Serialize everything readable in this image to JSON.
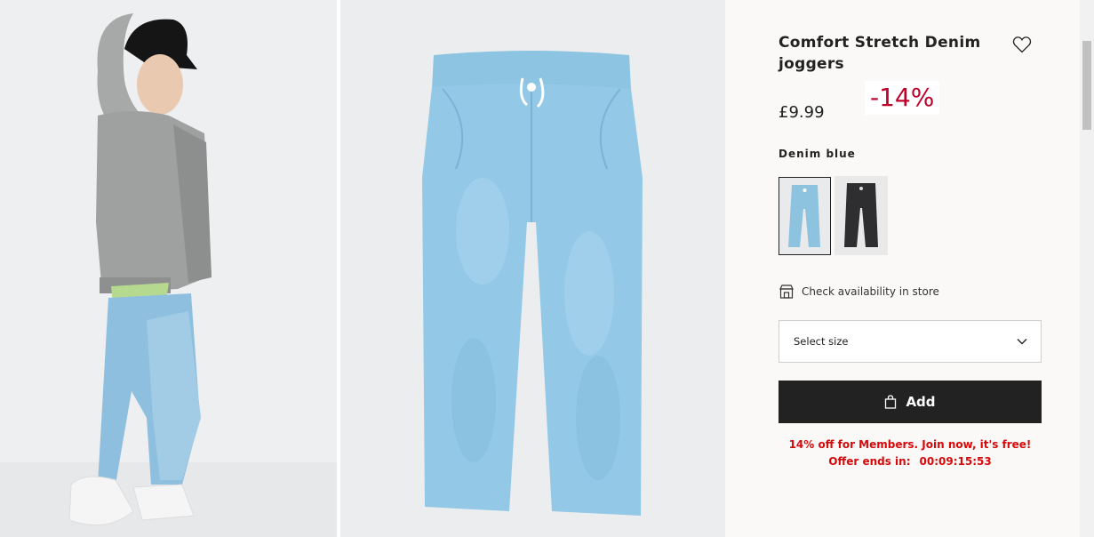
{
  "product": {
    "title": "Comfort Stretch Denim joggers",
    "price": "£9.99",
    "discount_badge": "-14%",
    "color_name": "Denim blue",
    "swatches": [
      {
        "name": "Denim blue",
        "selected": true,
        "color": "#8ec3e0"
      },
      {
        "name": "Black",
        "selected": false,
        "color": "#2e2e30"
      }
    ]
  },
  "actions": {
    "store_check": "Check availability in store",
    "size_placeholder": "Select size",
    "add_label": "Add"
  },
  "promo": {
    "members_text": "14% off for Members. Join now, it's free!",
    "offer_label": "Offer ends in:",
    "countdown": "00:09:15:53"
  },
  "icons": {
    "wishlist": "heart-icon",
    "store": "store-icon",
    "dropdown": "chevron-down-icon",
    "bag": "bag-icon"
  },
  "colors": {
    "accent_red": "#d60a0a",
    "badge_red": "#c0002a",
    "button_dark": "#222222"
  }
}
